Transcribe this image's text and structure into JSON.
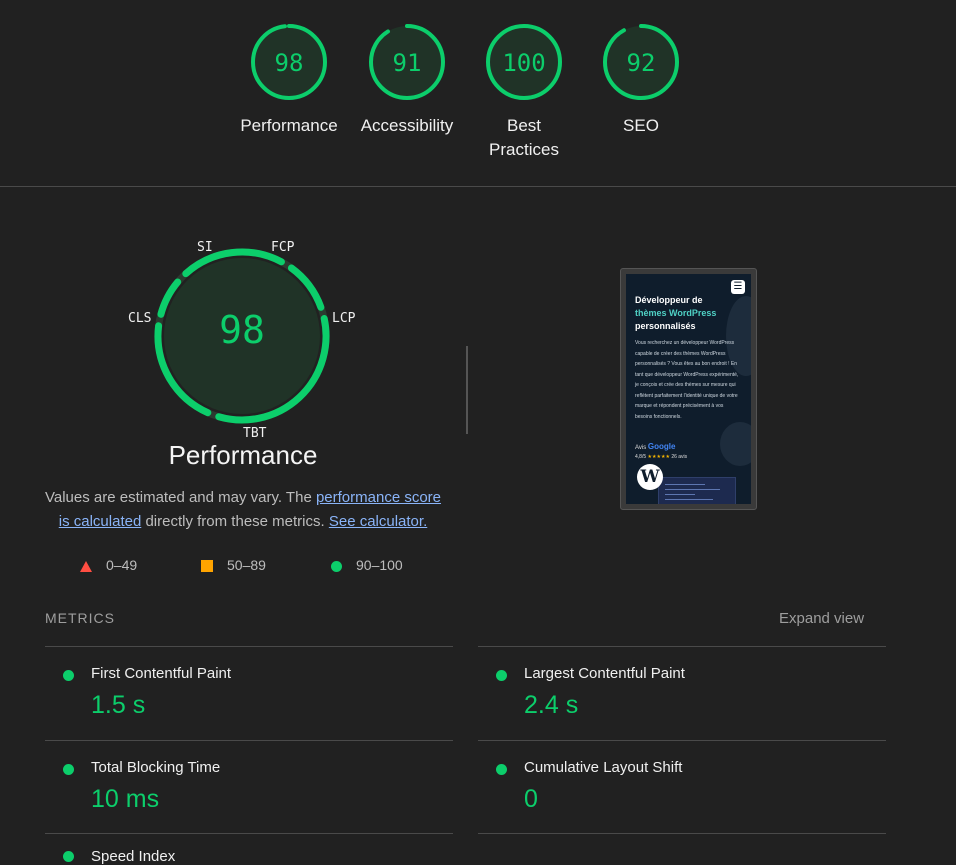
{
  "colors": {
    "pass": "#0cce6b",
    "average": "#ffa400",
    "fail": "#ff4e42",
    "background": "#212121"
  },
  "categories": [
    {
      "score": 98,
      "label": "Performance"
    },
    {
      "score": 91,
      "label": "Accessibility"
    },
    {
      "score": 100,
      "label": "Best\nPractices"
    },
    {
      "score": 92,
      "label": "SEO"
    }
  ],
  "performance": {
    "score": "98",
    "title": "Performance",
    "tags": {
      "si": "SI",
      "fcp": "FCP",
      "lcp": "LCP",
      "tbt": "TBT",
      "cls": "CLS"
    }
  },
  "screenshot": {
    "heading_1": "Développeur de",
    "heading_accent": "thèmes WordPress",
    "heading_3": "personnalisés",
    "paragraph": "Vous recherchez un développeur WordPress capable de créer des thèmes WordPress personnalisés ? Vous êtes au bon endroit ! En tant que développeur WordPress expérimenté, je conçois et crée des thèmes sur mesure qui reflètent parfaitement l'identité unique de votre marque et répondent précisément à vos besoins fonctionnels.",
    "reviews_prefix": "Avis",
    "reviews_brand": "Google",
    "rating": "4,8/5",
    "stars": "★★★★★",
    "review_count": "26 avis",
    "menu_icon": "☰",
    "wp_logo": "W"
  },
  "note": {
    "text_1": "Values are estimated and may vary. The ",
    "link_1": "performance score is calculated",
    "text_2": " directly from these metrics. ",
    "link_2": "See calculator."
  },
  "legend": {
    "fail": "0–49",
    "average": "50–89",
    "pass": "90–100"
  },
  "metrics": {
    "title": "METRICS",
    "expand_label": "Expand view",
    "items": [
      {
        "name": "First Contentful Paint",
        "value": "1.5 s"
      },
      {
        "name": "Largest Contentful Paint",
        "value": "2.4 s"
      },
      {
        "name": "Total Blocking Time",
        "value": "10 ms"
      },
      {
        "name": "Cumulative Layout Shift",
        "value": "0"
      },
      {
        "name": "Speed Index",
        "value": ""
      }
    ]
  }
}
